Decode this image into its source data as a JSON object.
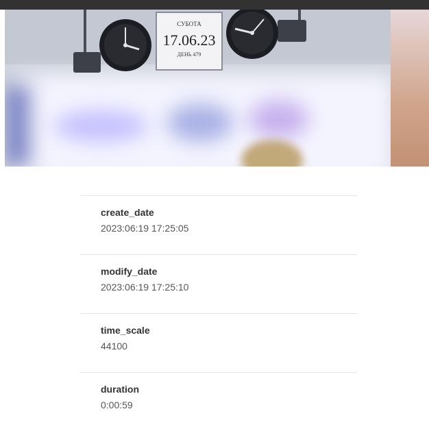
{
  "video": {
    "sign": {
      "day_name": "СУБОТА",
      "date": "17.06.23",
      "day_count": "ДЕНЬ 479"
    }
  },
  "metadata": [
    {
      "key": "create_date",
      "value": "2023:06:19 17:25:05"
    },
    {
      "key": "modify_date",
      "value": "2023:06:19 17:25:10"
    },
    {
      "key": "time_scale",
      "value": "44100"
    },
    {
      "key": "duration",
      "value": "0:00:59"
    }
  ]
}
